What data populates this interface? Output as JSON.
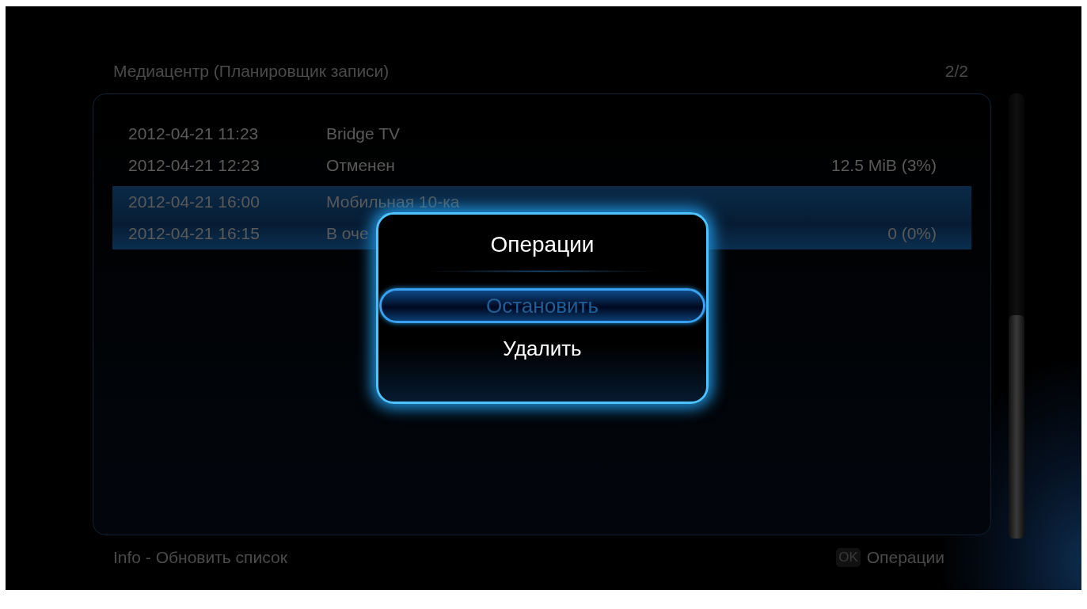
{
  "header": {
    "title": "Медиацентр (Планировщик записи)",
    "page": "2/2"
  },
  "recordings": [
    {
      "start": "2012-04-21 11:23",
      "title": "Bridge TV",
      "end": "2012-04-21 12:23",
      "status": "Отменен",
      "size": "12.5 MiB (3%)",
      "selected": false
    },
    {
      "start": "2012-04-21 16:00",
      "title": "Мобильная 10-ка",
      "end": "2012-04-21 16:15",
      "status": "В оче",
      "size": "0 (0%)",
      "selected": true
    }
  ],
  "dialog": {
    "title": "Операции",
    "options": [
      {
        "label": "Остановить",
        "selected": true
      },
      {
        "label": "Удалить",
        "selected": false
      }
    ]
  },
  "footer": {
    "hint": "Info - Обновить список",
    "key": "OK",
    "action": "Операции"
  }
}
